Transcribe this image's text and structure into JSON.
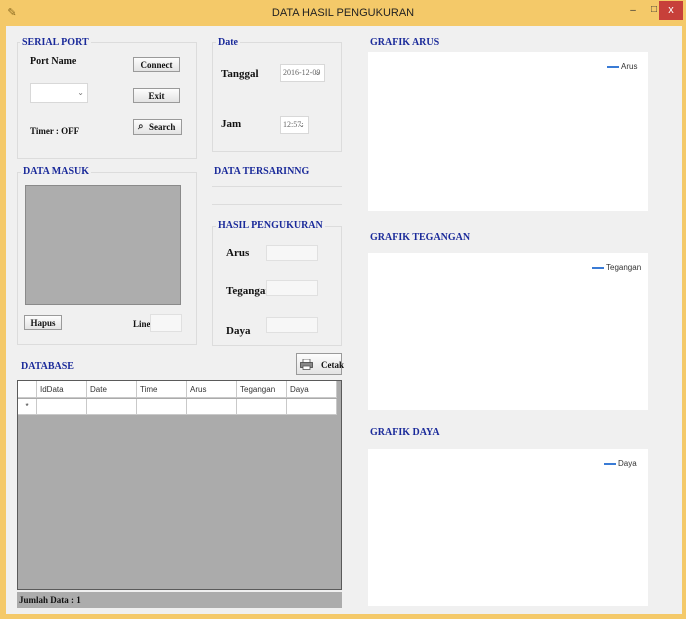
{
  "window": {
    "title": "DATA HASIL PENGUKURAN",
    "min_glyph": "–",
    "max_glyph": "□",
    "close_glyph": "x"
  },
  "serial_port": {
    "title": "SERIAL PORT",
    "port_name_label": "Port Name",
    "port_value": "",
    "connect_label": "Connect",
    "exit_label": "Exit",
    "search_label": "Search",
    "timer_label": "Timer : OFF"
  },
  "date_group": {
    "title": "Date",
    "tanggal_label": "Tanggal",
    "tanggal_value": "2016-12-09",
    "jam_label": "Jam",
    "jam_value": "12:57:"
  },
  "data_masuk": {
    "title": "DATA MASUK",
    "hapus_label": "Hapus",
    "line_label": "Line",
    "line_value": ""
  },
  "data_tersaring": {
    "title": "DATA TERSARINNG"
  },
  "hasil": {
    "title": "HASIL PENGUKURAN",
    "arus_label": "Arus",
    "arus_value": "",
    "tegangan_label": "Tegangan",
    "tegangan_value": "",
    "daya_label": "Daya",
    "daya_value": ""
  },
  "database": {
    "title": "DATABASE",
    "cetak_label": "Cetak",
    "columns": [
      "IdData",
      "Date",
      "Time",
      "Arus",
      "Tegangan",
      "Daya"
    ],
    "new_row_marker": "*",
    "status": "Jumlah Data : 1"
  },
  "charts": [
    {
      "title": "GRAFIK ARUS",
      "legend": "Arus"
    },
    {
      "title": "GRAFIK TEGANGAN",
      "legend": "Tegangan"
    },
    {
      "title": "GRAFIK DAYA",
      "legend": "Daya"
    }
  ],
  "colors": {
    "title_bar": "#f4c969",
    "close_button": "#c7403a",
    "group_title": "#1a2a9a",
    "legend_line": "#3a7bd5",
    "grid_background": "#ababab"
  },
  "icons": {
    "search": "magnifier-icon",
    "cetak": "printer-icon"
  }
}
